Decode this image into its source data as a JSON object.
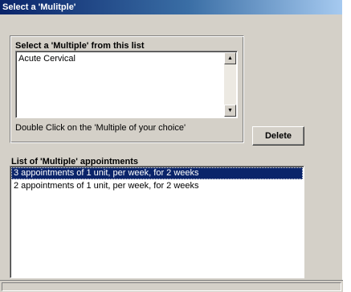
{
  "window": {
    "title": "Select a 'Mulitple'"
  },
  "multiples": {
    "heading": "Select a 'Multiple' from this list",
    "items": [
      "Acute Cervical"
    ],
    "hint": "Double Click on the 'Multiple of your choice'",
    "scroll_up_glyph": "▲",
    "scroll_down_glyph": "▼"
  },
  "actions": {
    "delete_label": "Delete"
  },
  "appointments": {
    "heading": "List of 'Multiple' appointments",
    "rows": [
      {
        "text": "3 appointments of 1 unit, per week, for 2 weeks",
        "selected": true
      },
      {
        "text": "2 appointments of 1 unit, per week, for 2 weeks",
        "selected": false
      }
    ]
  },
  "colors": {
    "selection": "#0a246a",
    "face": "#d4d0c8",
    "title_gradient_start": "#0a246a",
    "title_gradient_end": "#a6caf0"
  }
}
